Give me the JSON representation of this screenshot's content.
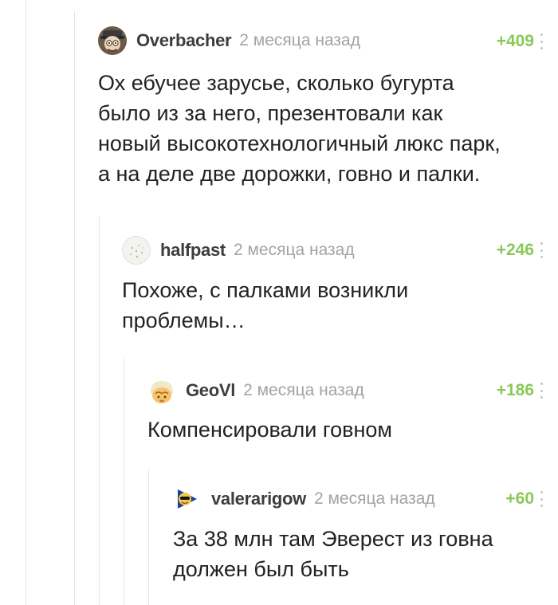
{
  "colors": {
    "rating": "#8ac858",
    "username": "#3d3d3d",
    "timestamp": "#a3a3a3",
    "thread_line": "#e3e3e3"
  },
  "comments": [
    {
      "username": "Overbacher",
      "time": "2 месяца назад",
      "rating": "+409",
      "text": "Ох ебучее зарусье, сколько бугурта\nбыло из за него, презентовали как\nновый высокотехнологичный люкс парк,\nа на деле две дорожки, говно и палки.",
      "avatar_icon": "cartoon-avatar-icon"
    },
    {
      "username": "halfpast",
      "time": "2 месяца назад",
      "rating": "+246",
      "text": "Похоже, с палками возникли\nпроблемы…",
      "avatar_icon": "dotted-avatar-icon"
    },
    {
      "username": "GeoVl",
      "time": "2 месяца назад",
      "rating": "+186",
      "text": "Компенсировали говном",
      "avatar_icon": "face-avatar-icon"
    },
    {
      "username": "valerarigow",
      "time": "2 месяца назад",
      "rating": "+60",
      "text": "За 38 млн там Эверест из говна\nдолжен был быть",
      "avatar_icon": "sunglasses-avatar-icon"
    }
  ]
}
